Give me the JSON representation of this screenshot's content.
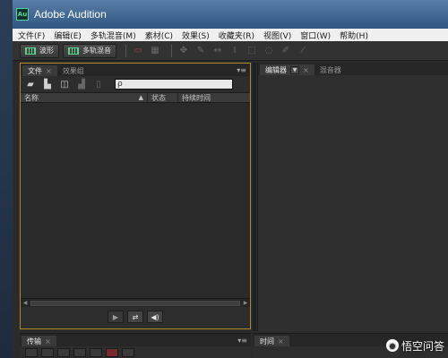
{
  "window": {
    "title": "Adobe Audition",
    "logo_text": "Au"
  },
  "menu": [
    "文件(F)",
    "编辑(E)",
    "多轨混音(M)",
    "素材(C)",
    "效果(S)",
    "收藏夹(R)",
    "视图(V)",
    "窗口(W)",
    "帮助(H)"
  ],
  "toolbar": {
    "waveform_label": "波形",
    "multitrack_label": "多轨混音"
  },
  "files_panel": {
    "tab_files": "文件",
    "tab_effects": "效果组",
    "columns": {
      "name": "名称",
      "status": "状态",
      "duration": "持续时间"
    },
    "search_value": "ρ"
  },
  "editor_panel": {
    "tab_editor": "编辑器",
    "tab_mixer": "混音器"
  },
  "bottom": {
    "transport_tab": "传输",
    "time_tab": "时间"
  },
  "watermark": "悟空问答",
  "colors": {
    "accent_active_panel": "#b38a22",
    "titlebar": "#3f6690",
    "waveform_icon": "#5bd38f"
  }
}
